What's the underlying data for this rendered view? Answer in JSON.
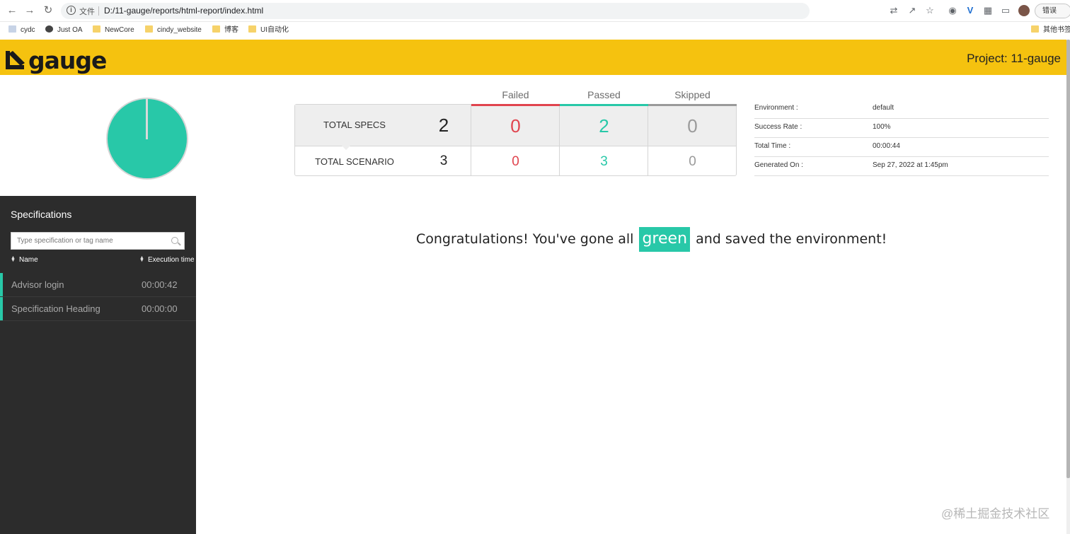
{
  "browser": {
    "address_scheme": "文件",
    "url": "D:/11-gauge/reports/html-report/index.html",
    "error_label": "错误",
    "bookmarks": [
      "cydc",
      "Just OA",
      "NewCore",
      "cindy_website",
      "博客",
      "UI自动化"
    ],
    "other_bookmarks": "其他书签"
  },
  "header": {
    "logo_text": "gauge",
    "project_label": "Project: 11-gauge",
    "brand_color": "#f5c20f"
  },
  "stats": {
    "columns": [
      "Failed",
      "Passed",
      "Skipped"
    ],
    "specs": {
      "label": "TOTAL SPECS",
      "total": "2",
      "failed": "0",
      "passed": "2",
      "skipped": "0"
    },
    "scenarios": {
      "label": "TOTAL SCENARIO",
      "total": "3",
      "failed": "0",
      "passed": "3",
      "skipped": "0"
    },
    "colors": {
      "failed": "#e0444e",
      "passed": "#28c8a8",
      "skipped": "#9a9a9a"
    }
  },
  "summary_pie": {
    "passed_fraction": 1.0,
    "failed_fraction": 0.0,
    "skipped_fraction": 0.0
  },
  "info": [
    {
      "key": "Environment :",
      "value": "default"
    },
    {
      "key": "Success Rate :",
      "value": "100%"
    },
    {
      "key": "Total Time :",
      "value": "00:00:44"
    },
    {
      "key": "Generated On :",
      "value": "Sep 27, 2022 at 1:45pm"
    }
  ],
  "sidebar": {
    "title": "Specifications",
    "search_placeholder": "Type specification or tag name",
    "sort_name": "Name",
    "sort_time": "Execution time",
    "specs": [
      {
        "name": "Advisor login",
        "time": "00:00:42"
      },
      {
        "name": "Specification Heading",
        "time": "00:00:00"
      }
    ]
  },
  "message": {
    "before": "Congratulations! You've gone all",
    "highlight": "green",
    "after": "and saved the environment!"
  },
  "watermark": "@稀土掘金技术社区"
}
